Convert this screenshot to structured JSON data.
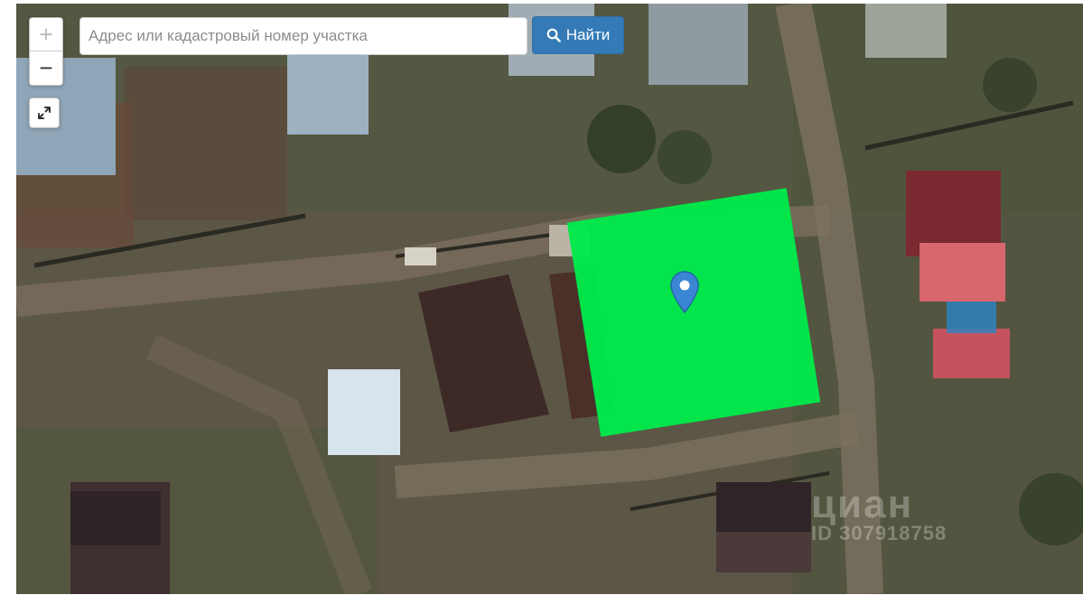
{
  "search": {
    "placeholder": "Адрес или кадастровый номер участка",
    "value": "",
    "button_label": "Найти",
    "button_icon": "search-icon"
  },
  "controls": {
    "zoom_in": "+",
    "zoom_out": "−",
    "fullscreen_icon": "expand-arrows-icon"
  },
  "map": {
    "type": "satellite",
    "plot_color": "#00e94a",
    "marker_color": "#3a86d4"
  },
  "watermark": {
    "logo": "циан",
    "id": "ID 307918758"
  }
}
